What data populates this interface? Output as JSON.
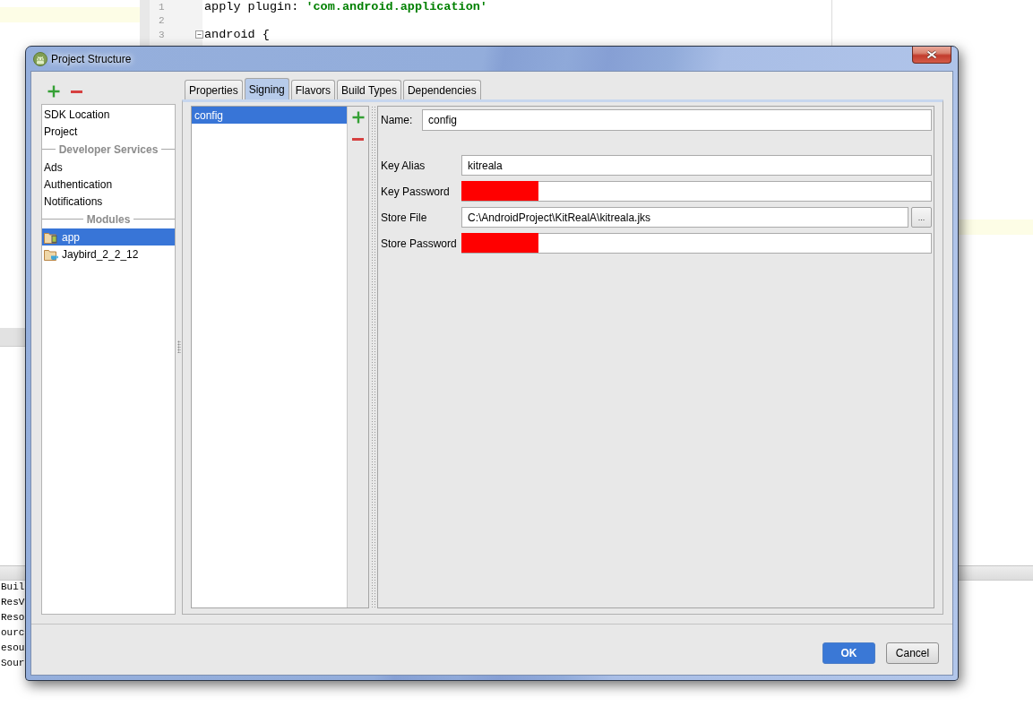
{
  "editor": {
    "lines": [
      {
        "number": "1",
        "code": "apply plugin: **'com.android.application'**",
        "fold": false
      },
      {
        "number": "2",
        "fold": false
      },
      {
        "number": "3",
        "code": "android {",
        "fold": true
      }
    ]
  },
  "console": {
    "lines": [
      "Buil",
      "ResV",
      "Reso",
      "ourc",
      "esou",
      "Sour"
    ]
  },
  "dialog": {
    "title": "Project Structure",
    "sidebar": {
      "items": [
        {
          "kind": "item",
          "label": "SDK Location",
          "selected": false
        },
        {
          "kind": "item",
          "label": "Project",
          "selected": false
        },
        {
          "kind": "separator",
          "label": "Developer Services"
        },
        {
          "kind": "item",
          "label": "Ads",
          "selected": false
        },
        {
          "kind": "item",
          "label": "Authentication",
          "selected": false
        },
        {
          "kind": "item",
          "label": "Notifications",
          "selected": false
        },
        {
          "kind": "separator",
          "label": "Modules"
        },
        {
          "kind": "android",
          "label": "app",
          "selected": true
        },
        {
          "kind": "library",
          "label": "Jaybird_2_2_12",
          "selected": false
        }
      ]
    },
    "tabs": [
      {
        "label": "Properties",
        "selected": false
      },
      {
        "label": "Signing",
        "selected": true
      },
      {
        "label": "Flavors",
        "selected": false
      },
      {
        "label": "Build Types",
        "selected": false
      },
      {
        "label": "Dependencies",
        "selected": false
      }
    ],
    "signing": {
      "configs": [
        {
          "label": "config",
          "selected": true
        }
      ],
      "name_field": {
        "label": "Name:",
        "value": "config"
      },
      "fields": [
        {
          "kind": "text",
          "label": "Key Alias",
          "value": "kitreala",
          "redacted": false
        },
        {
          "kind": "text",
          "label": "Key Password",
          "redacted": true
        },
        {
          "kind": "file",
          "label": "Store File",
          "value": "C:\\AndroidProject\\KitRealA\\kitreala.jks",
          "redacted": false,
          "browse_label": "..."
        },
        {
          "kind": "text",
          "label": "Store Password",
          "redacted": true
        }
      ]
    },
    "buttons": [
      {
        "kind": "default",
        "label": "OK"
      },
      {
        "kind": "normal",
        "label": "Cancel"
      }
    ]
  }
}
